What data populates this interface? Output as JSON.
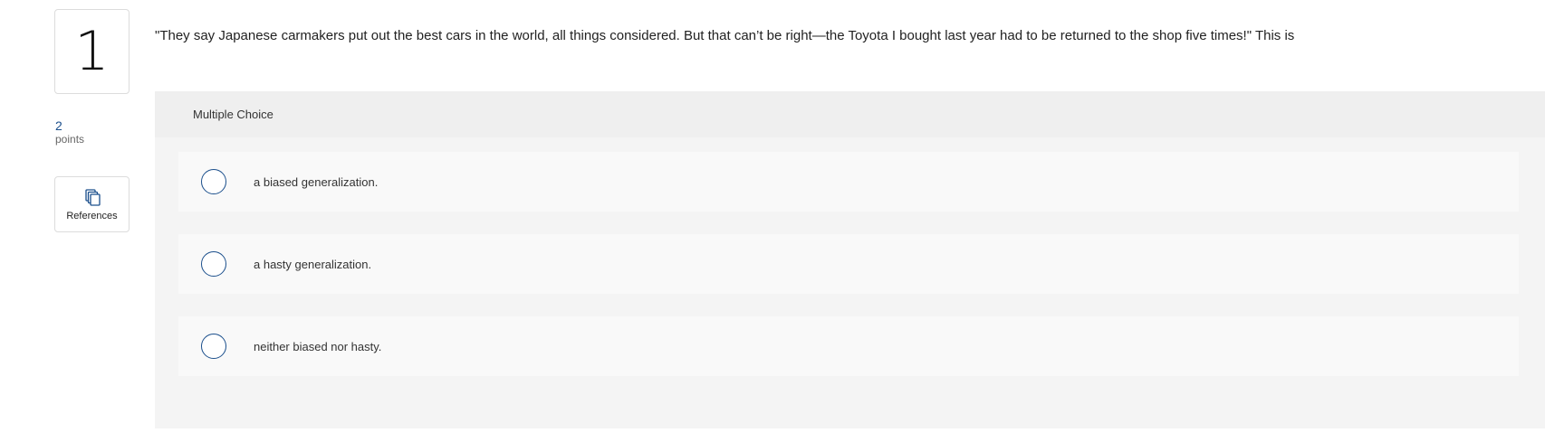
{
  "question": {
    "number": "1",
    "points_value": "2",
    "points_label": "points",
    "prompt": "\"They say Japanese carmakers put out the best cars in the world, all things considered. But that can’t be right—the Toyota I bought last year had to be returned to the shop five times!\" This is"
  },
  "references": {
    "label": "References",
    "icon": "copy-documents-icon"
  },
  "multiple_choice": {
    "type_label": "Multiple Choice",
    "options": [
      {
        "label": "a biased generalization.",
        "selected": false
      },
      {
        "label": "a hasty generalization.",
        "selected": false
      },
      {
        "label": "neither biased nor hasty.",
        "selected": false
      }
    ]
  },
  "colors": {
    "accent": "#1b4f8c",
    "panel_bg": "#f4f4f4",
    "option_bg": "#f9f9f9"
  }
}
